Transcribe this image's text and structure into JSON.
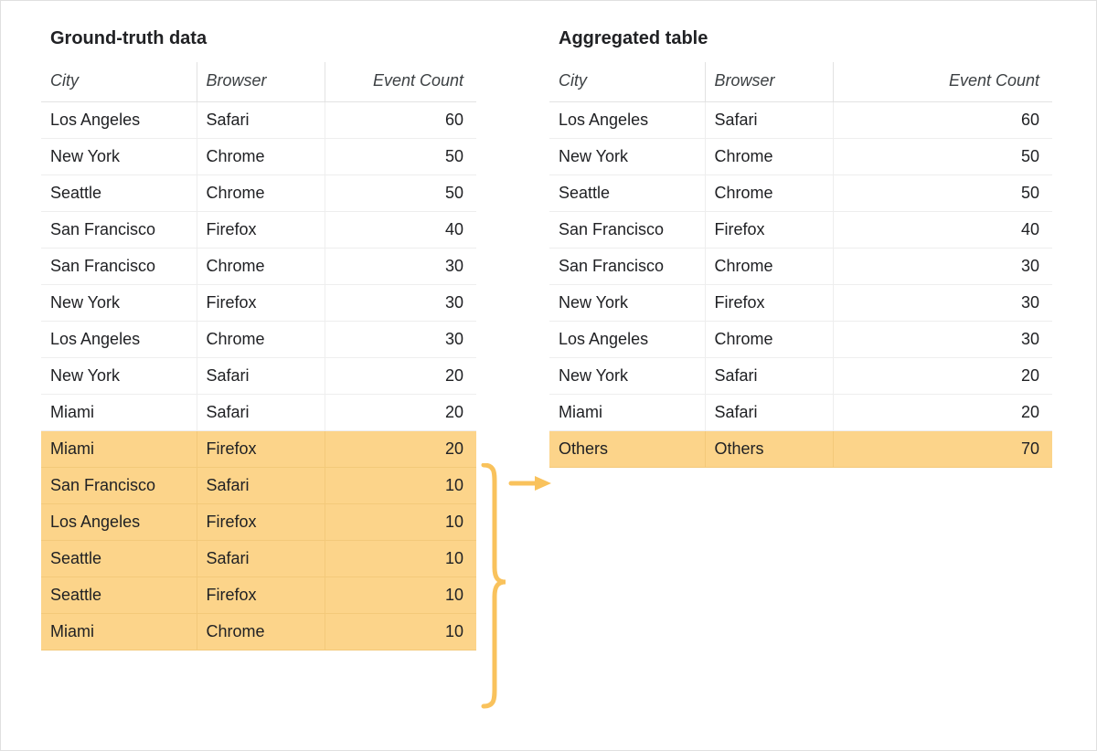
{
  "left": {
    "title": "Ground-truth data",
    "columns": {
      "city": "City",
      "browser": "Browser",
      "count": "Event Count"
    },
    "rows": [
      {
        "city": "Los Angeles",
        "browser": "Safari",
        "count": 60,
        "hl": false
      },
      {
        "city": "New York",
        "browser": "Chrome",
        "count": 50,
        "hl": false
      },
      {
        "city": "Seattle",
        "browser": "Chrome",
        "count": 50,
        "hl": false
      },
      {
        "city": "San Francisco",
        "browser": "Firefox",
        "count": 40,
        "hl": false
      },
      {
        "city": "San Francisco",
        "browser": "Chrome",
        "count": 30,
        "hl": false
      },
      {
        "city": "New York",
        "browser": "Firefox",
        "count": 30,
        "hl": false
      },
      {
        "city": "Los Angeles",
        "browser": "Chrome",
        "count": 30,
        "hl": false
      },
      {
        "city": "New York",
        "browser": "Safari",
        "count": 20,
        "hl": false
      },
      {
        "city": "Miami",
        "browser": "Safari",
        "count": 20,
        "hl": false
      },
      {
        "city": "Miami",
        "browser": "Firefox",
        "count": 20,
        "hl": true
      },
      {
        "city": "San Francisco",
        "browser": "Safari",
        "count": 10,
        "hl": true
      },
      {
        "city": "Los Angeles",
        "browser": "Firefox",
        "count": 10,
        "hl": true
      },
      {
        "city": "Seattle",
        "browser": "Safari",
        "count": 10,
        "hl": true
      },
      {
        "city": "Seattle",
        "browser": "Firefox",
        "count": 10,
        "hl": true
      },
      {
        "city": "Miami",
        "browser": "Chrome",
        "count": 10,
        "hl": true
      }
    ]
  },
  "right": {
    "title": "Aggregated table",
    "columns": {
      "city": "City",
      "browser": "Browser",
      "count": "Event Count"
    },
    "rows": [
      {
        "city": "Los Angeles",
        "browser": "Safari",
        "count": 60,
        "hl": false
      },
      {
        "city": "New York",
        "browser": "Chrome",
        "count": 50,
        "hl": false
      },
      {
        "city": "Seattle",
        "browser": "Chrome",
        "count": 50,
        "hl": false
      },
      {
        "city": "San Francisco",
        "browser": "Firefox",
        "count": 40,
        "hl": false
      },
      {
        "city": "San Francisco",
        "browser": "Chrome",
        "count": 30,
        "hl": false
      },
      {
        "city": "New York",
        "browser": "Firefox",
        "count": 30,
        "hl": false
      },
      {
        "city": "Los Angeles",
        "browser": "Chrome",
        "count": 30,
        "hl": false
      },
      {
        "city": "New York",
        "browser": "Safari",
        "count": 20,
        "hl": false
      },
      {
        "city": "Miami",
        "browser": "Safari",
        "count": 20,
        "hl": false
      },
      {
        "city": "Others",
        "browser": "Others",
        "count": 70,
        "hl": true
      }
    ]
  },
  "colors": {
    "highlight": "#fcd48a",
    "arrow": "#f9c25c"
  }
}
